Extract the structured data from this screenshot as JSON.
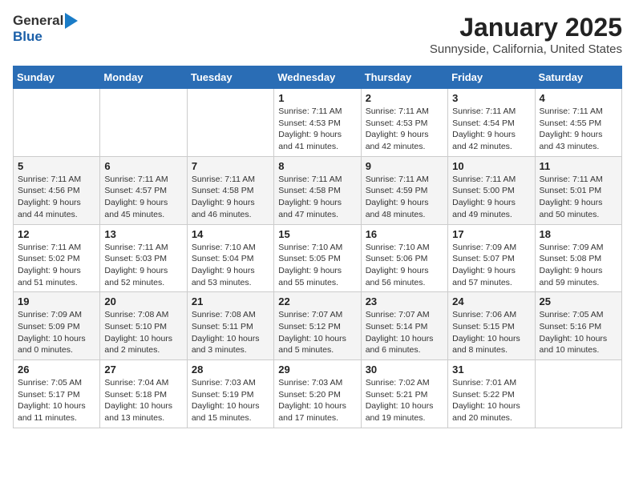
{
  "header": {
    "logo_line1": "General",
    "logo_line2": "Blue",
    "month_year": "January 2025",
    "location": "Sunnyside, California, United States"
  },
  "days_of_week": [
    "Sunday",
    "Monday",
    "Tuesday",
    "Wednesday",
    "Thursday",
    "Friday",
    "Saturday"
  ],
  "weeks": [
    [
      {
        "day": "",
        "info": ""
      },
      {
        "day": "",
        "info": ""
      },
      {
        "day": "",
        "info": ""
      },
      {
        "day": "1",
        "info": "Sunrise: 7:11 AM\nSunset: 4:53 PM\nDaylight: 9 hours\nand 41 minutes."
      },
      {
        "day": "2",
        "info": "Sunrise: 7:11 AM\nSunset: 4:53 PM\nDaylight: 9 hours\nand 42 minutes."
      },
      {
        "day": "3",
        "info": "Sunrise: 7:11 AM\nSunset: 4:54 PM\nDaylight: 9 hours\nand 42 minutes."
      },
      {
        "day": "4",
        "info": "Sunrise: 7:11 AM\nSunset: 4:55 PM\nDaylight: 9 hours\nand 43 minutes."
      }
    ],
    [
      {
        "day": "5",
        "info": "Sunrise: 7:11 AM\nSunset: 4:56 PM\nDaylight: 9 hours\nand 44 minutes."
      },
      {
        "day": "6",
        "info": "Sunrise: 7:11 AM\nSunset: 4:57 PM\nDaylight: 9 hours\nand 45 minutes."
      },
      {
        "day": "7",
        "info": "Sunrise: 7:11 AM\nSunset: 4:58 PM\nDaylight: 9 hours\nand 46 minutes."
      },
      {
        "day": "8",
        "info": "Sunrise: 7:11 AM\nSunset: 4:58 PM\nDaylight: 9 hours\nand 47 minutes."
      },
      {
        "day": "9",
        "info": "Sunrise: 7:11 AM\nSunset: 4:59 PM\nDaylight: 9 hours\nand 48 minutes."
      },
      {
        "day": "10",
        "info": "Sunrise: 7:11 AM\nSunset: 5:00 PM\nDaylight: 9 hours\nand 49 minutes."
      },
      {
        "day": "11",
        "info": "Sunrise: 7:11 AM\nSunset: 5:01 PM\nDaylight: 9 hours\nand 50 minutes."
      }
    ],
    [
      {
        "day": "12",
        "info": "Sunrise: 7:11 AM\nSunset: 5:02 PM\nDaylight: 9 hours\nand 51 minutes."
      },
      {
        "day": "13",
        "info": "Sunrise: 7:11 AM\nSunset: 5:03 PM\nDaylight: 9 hours\nand 52 minutes."
      },
      {
        "day": "14",
        "info": "Sunrise: 7:10 AM\nSunset: 5:04 PM\nDaylight: 9 hours\nand 53 minutes."
      },
      {
        "day": "15",
        "info": "Sunrise: 7:10 AM\nSunset: 5:05 PM\nDaylight: 9 hours\nand 55 minutes."
      },
      {
        "day": "16",
        "info": "Sunrise: 7:10 AM\nSunset: 5:06 PM\nDaylight: 9 hours\nand 56 minutes."
      },
      {
        "day": "17",
        "info": "Sunrise: 7:09 AM\nSunset: 5:07 PM\nDaylight: 9 hours\nand 57 minutes."
      },
      {
        "day": "18",
        "info": "Sunrise: 7:09 AM\nSunset: 5:08 PM\nDaylight: 9 hours\nand 59 minutes."
      }
    ],
    [
      {
        "day": "19",
        "info": "Sunrise: 7:09 AM\nSunset: 5:09 PM\nDaylight: 10 hours\nand 0 minutes."
      },
      {
        "day": "20",
        "info": "Sunrise: 7:08 AM\nSunset: 5:10 PM\nDaylight: 10 hours\nand 2 minutes."
      },
      {
        "day": "21",
        "info": "Sunrise: 7:08 AM\nSunset: 5:11 PM\nDaylight: 10 hours\nand 3 minutes."
      },
      {
        "day": "22",
        "info": "Sunrise: 7:07 AM\nSunset: 5:12 PM\nDaylight: 10 hours\nand 5 minutes."
      },
      {
        "day": "23",
        "info": "Sunrise: 7:07 AM\nSunset: 5:14 PM\nDaylight: 10 hours\nand 6 minutes."
      },
      {
        "day": "24",
        "info": "Sunrise: 7:06 AM\nSunset: 5:15 PM\nDaylight: 10 hours\nand 8 minutes."
      },
      {
        "day": "25",
        "info": "Sunrise: 7:05 AM\nSunset: 5:16 PM\nDaylight: 10 hours\nand 10 minutes."
      }
    ],
    [
      {
        "day": "26",
        "info": "Sunrise: 7:05 AM\nSunset: 5:17 PM\nDaylight: 10 hours\nand 11 minutes."
      },
      {
        "day": "27",
        "info": "Sunrise: 7:04 AM\nSunset: 5:18 PM\nDaylight: 10 hours\nand 13 minutes."
      },
      {
        "day": "28",
        "info": "Sunrise: 7:03 AM\nSunset: 5:19 PM\nDaylight: 10 hours\nand 15 minutes."
      },
      {
        "day": "29",
        "info": "Sunrise: 7:03 AM\nSunset: 5:20 PM\nDaylight: 10 hours\nand 17 minutes."
      },
      {
        "day": "30",
        "info": "Sunrise: 7:02 AM\nSunset: 5:21 PM\nDaylight: 10 hours\nand 19 minutes."
      },
      {
        "day": "31",
        "info": "Sunrise: 7:01 AM\nSunset: 5:22 PM\nDaylight: 10 hours\nand 20 minutes."
      },
      {
        "day": "",
        "info": ""
      }
    ]
  ]
}
